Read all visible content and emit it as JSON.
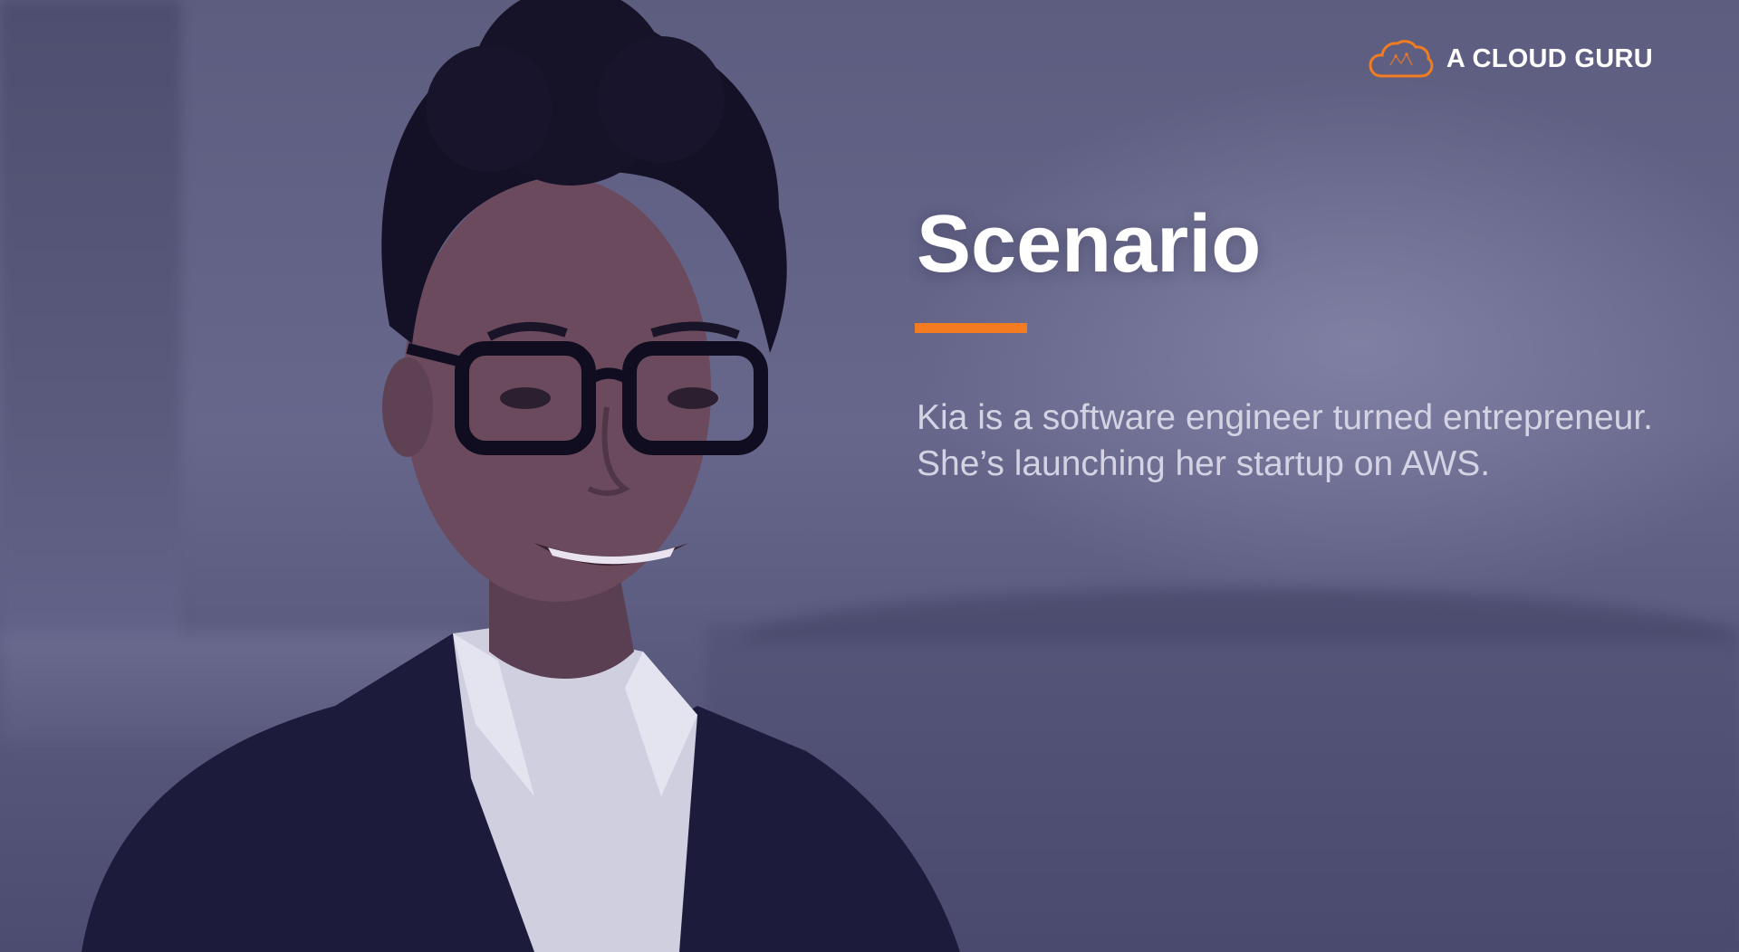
{
  "logo": {
    "text": "A CLOUD GURU",
    "icon": "cloud-logo-icon",
    "icon_color": "#f37c20"
  },
  "slide": {
    "title": "Scenario",
    "body": "Kia is a software engineer turned entrepreneur. She’s launching her startup on AWS.",
    "accent_color": "#f37c20",
    "background_tint": "#5e5e82"
  },
  "image": {
    "subject": "portrait-photo"
  }
}
